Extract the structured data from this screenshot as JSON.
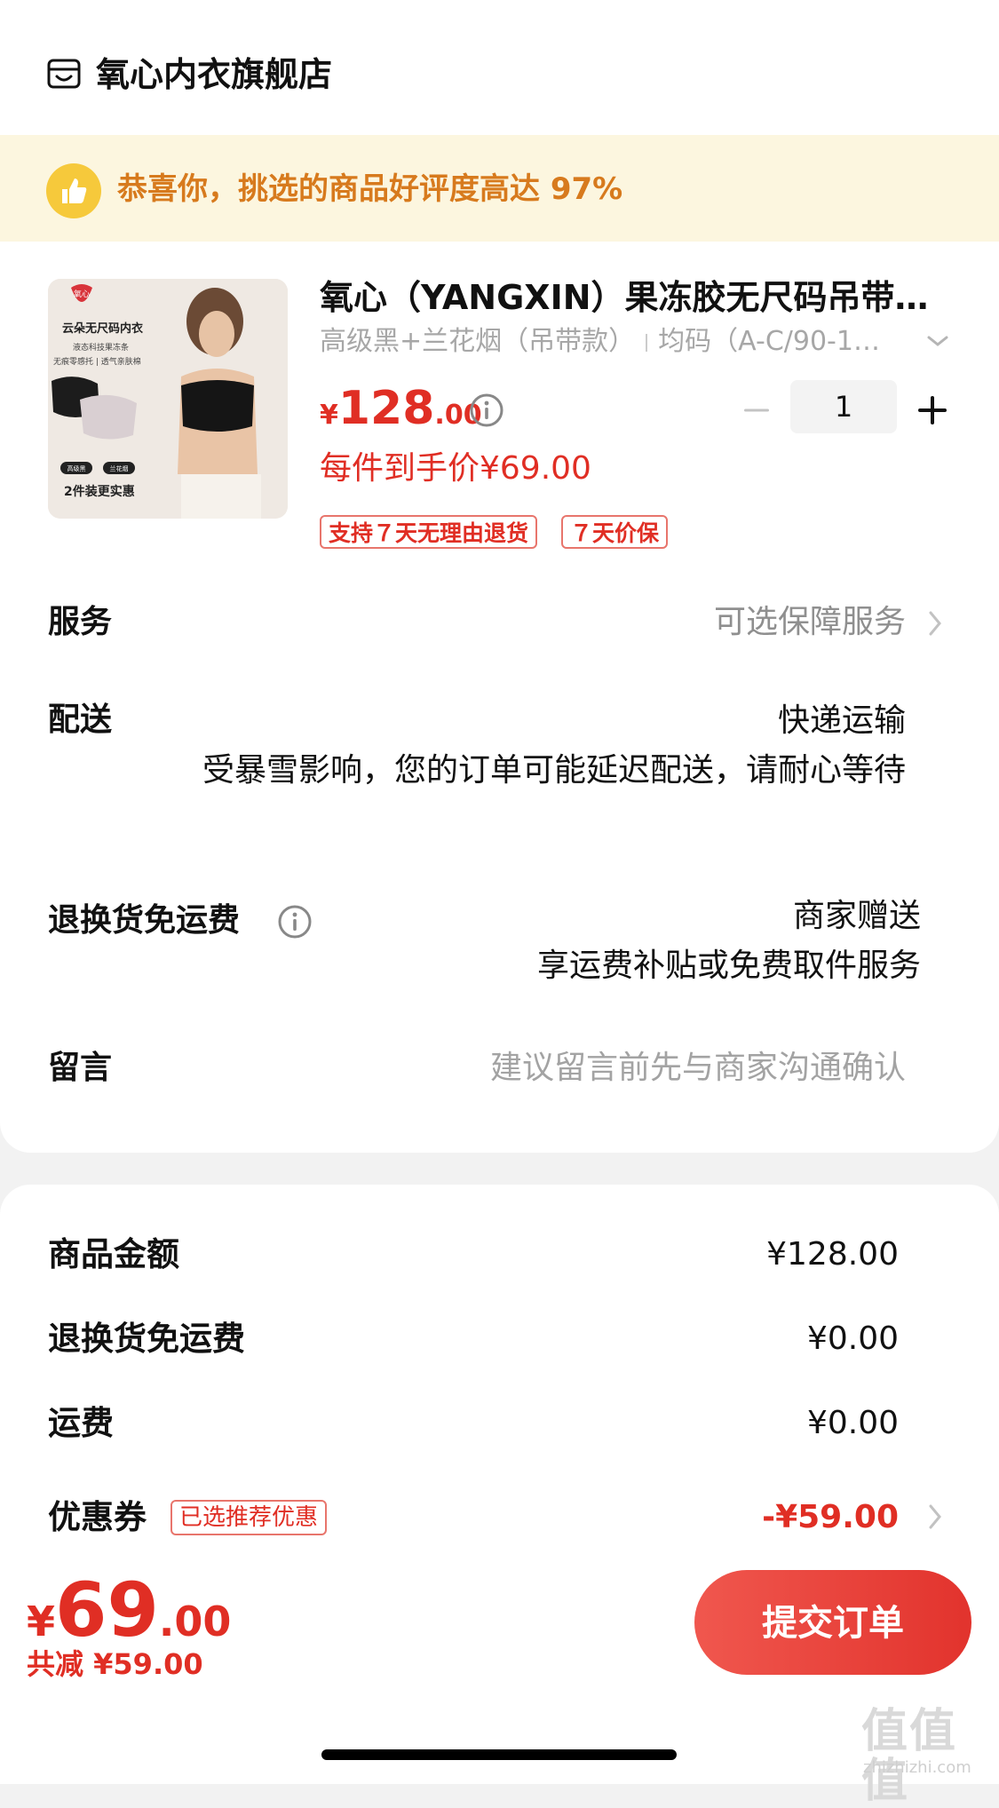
{
  "store": {
    "name": "氧心内衣旗舰店",
    "icon": "store-icon"
  },
  "banner": {
    "text": "恭喜你，挑选的商品好评度高达 97%",
    "icon": "thumbs-up-icon"
  },
  "product": {
    "title": "氧心（YANGXIN）果冻胶无尺码吊带…",
    "spec_color": "高级黑+兰花烟（吊带款）",
    "spec_size": "均码（A-C/90-1…",
    "price_symbol": "¥",
    "price_int": "128",
    "price_dec": ".00",
    "quantity": "1",
    "per_unit_price": "每件到手价¥69.00",
    "tags": [
      "支持７天无理由退货",
      "７天价保"
    ],
    "image_texts": {
      "brand": "氧心",
      "headline": "云朵无尺码内衣",
      "line1": "液态科技果冻条",
      "line2": "无痕零感托 | 透气亲肤棉",
      "chip1": "高级黑",
      "chip2": "兰花烟",
      "promo": "2件装更实惠"
    }
  },
  "rows": {
    "service": {
      "label": "服务",
      "value": "可选保障服务"
    },
    "delivery": {
      "label": "配送",
      "method": "快递运输",
      "notice": "受暴雪影响，您的订单可能延迟配送，请耐心等待"
    },
    "return_shipping": {
      "label": "退换货免运费",
      "value": "商家赠送",
      "sub": "享运费补贴或免费取件服务"
    },
    "message": {
      "label": "留言",
      "placeholder": "建议留言前先与商家沟通确认"
    }
  },
  "summary": {
    "goods_amount": {
      "label": "商品金额",
      "value": "¥128.00"
    },
    "return_fee": {
      "label": "退换货免运费",
      "value": "¥0.00"
    },
    "shipping": {
      "label": "运费",
      "value": "¥0.00"
    },
    "coupon": {
      "label": "优惠券",
      "tag": "已选推荐优惠",
      "value": "-¥59.00"
    }
  },
  "footer": {
    "total_symbol": "¥",
    "total_int": "69",
    "total_dec": ".00",
    "saved": "共减 ¥59.00",
    "submit_label": "提交订单"
  },
  "watermark": {
    "main": "值值值",
    "sub": "zhizhizhi.com"
  },
  "colors": {
    "accent_red": "#e02e24",
    "banner_bg": "#fcf6df",
    "banner_text": "#d77a1d"
  }
}
